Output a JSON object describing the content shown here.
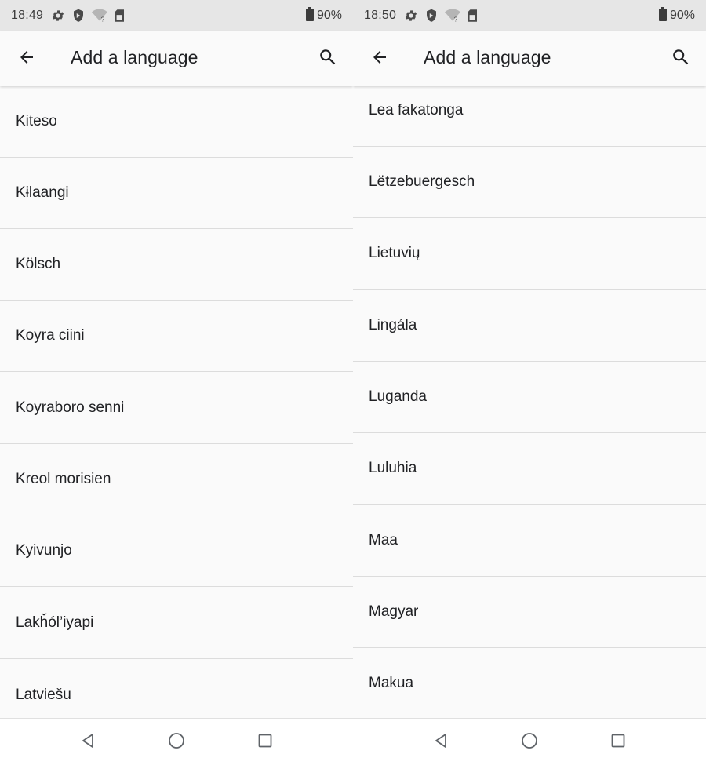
{
  "screens": [
    {
      "status": {
        "time": "18:49",
        "battery": "90%"
      },
      "app_bar": {
        "title": "Add a language"
      },
      "items": [
        "Kiteso",
        "Kɨlaangi",
        "Kölsch",
        "Koyra ciini",
        "Koyraboro senni",
        "Kreol morisien",
        "Kyivunjo",
        "Lakȟól’iyapi",
        "Latviešu"
      ]
    },
    {
      "status": {
        "time": "18:50",
        "battery": "90%"
      },
      "app_bar": {
        "title": "Add a language"
      },
      "items": [
        "Lea fakatonga",
        "Lëtzebuergesch",
        "Lietuvių",
        "Lingála",
        "Luganda",
        "Luluhia",
        "Maa",
        "Magyar",
        "Makua"
      ]
    }
  ],
  "icons": {
    "status_left": [
      "gear-icon",
      "shield-icon",
      "wifi-question-icon",
      "sim-card-icon"
    ],
    "status_right": [
      "battery-icon"
    ],
    "app_bar": [
      "back-arrow-icon",
      "search-icon"
    ],
    "nav": [
      "back-triangle-icon",
      "home-circle-icon",
      "recents-square-icon"
    ]
  },
  "colors": {
    "status_bar_bg": "#e6e6e6",
    "background": "#fafafa",
    "text": "#202124",
    "divider": "#dcdcdc"
  }
}
